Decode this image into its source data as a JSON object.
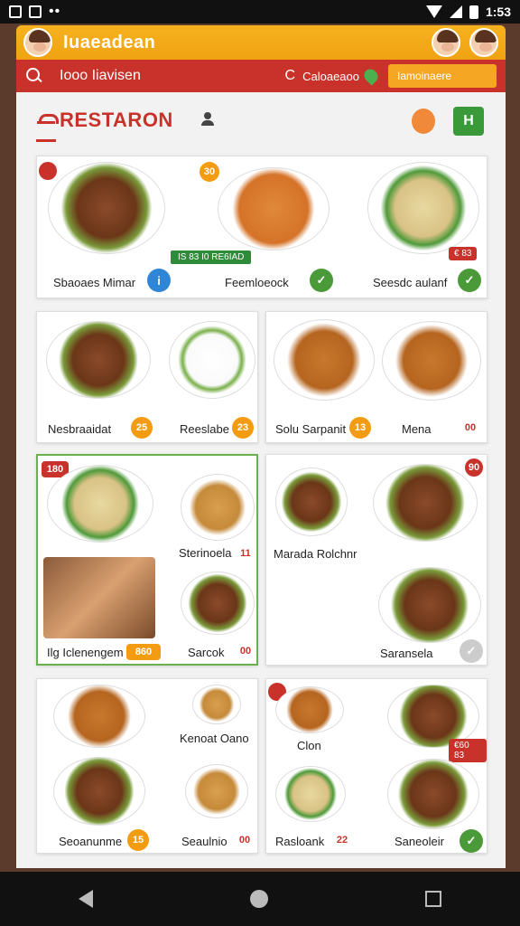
{
  "status_bar": {
    "time": "1:53"
  },
  "top_bar": {
    "title": "Iuaeadean"
  },
  "search_bar": {
    "placeholder": "Iooo Iiavisen",
    "c_glyph": "C",
    "category": "Caloaeaoo",
    "button_label": "Iamoinaere"
  },
  "panel": {
    "title": "RESTARON",
    "home_button": "H"
  },
  "cards": {
    "card1": {
      "pill": "IS 83 I0 RE6IAD",
      "items": [
        {
          "label": "Sbaoaes Mimar",
          "icon": "blue-info-icon"
        },
        {
          "label": "Feemloeock",
          "icon": "green-check-icon"
        },
        {
          "label": "Seesdc aulanf",
          "icon": "green-check-icon"
        }
      ],
      "badge_top_left": "",
      "badge_top_mid": "30",
      "red_pill": "€ 83"
    },
    "card2": {
      "items": [
        {
          "label": "Nesbraaidat",
          "badge": "25"
        },
        {
          "label": "Reeslabe",
          "badge": "23"
        }
      ]
    },
    "card3": {
      "items": [
        {
          "label": "Solu Sarpanit",
          "badge": "13"
        },
        {
          "label": "Mena",
          "badge": "00"
        }
      ]
    },
    "card4": {
      "badge_top": "180",
      "items": [
        {
          "label": "Sterinoela",
          "badge": "11"
        },
        {
          "label": "Sarcok",
          "badge": "00"
        },
        {
          "label": "Ilg Iclenengem",
          "badge": "860"
        }
      ]
    },
    "card5": {
      "badge_top": "90",
      "items": [
        {
          "label": "Marada Rolchnr"
        },
        {
          "label": "Saransela"
        }
      ]
    },
    "card6": {
      "items": [
        {
          "label": "Kenoat Oano"
        },
        {
          "label": "Seoanunme",
          "badge": "15"
        },
        {
          "label": "Seaulnio",
          "badge": "00"
        }
      ]
    },
    "card7": {
      "red_pill": "€60 83",
      "items": [
        {
          "label": "Clon"
        },
        {
          "label": "Rasloank",
          "badge": "22"
        },
        {
          "label": "Saneoleir"
        }
      ]
    }
  }
}
